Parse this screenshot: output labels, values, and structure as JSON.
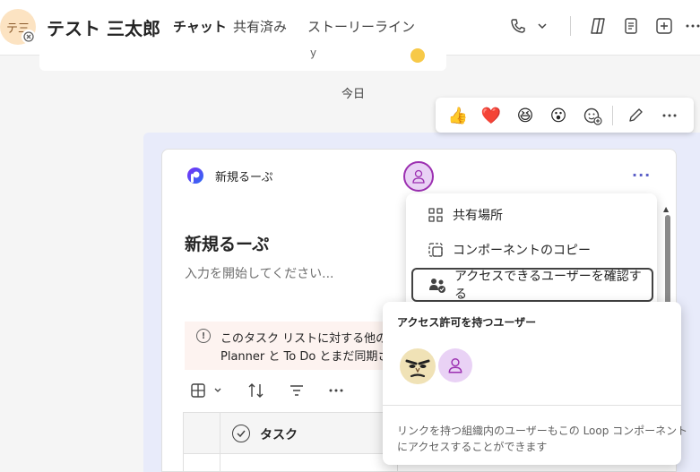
{
  "header": {
    "avatar_initials": "テ三",
    "title": "テスト 三太郎",
    "tabs": [
      {
        "label": "チャット",
        "active": true
      },
      {
        "label": "共有済み",
        "active": false
      },
      {
        "label": "ストーリーライン",
        "active": false
      }
    ],
    "icons": [
      "phone-icon",
      "chevron-down-icon",
      "copilot-icon",
      "notes-icon",
      "add-icon",
      "more-icon"
    ]
  },
  "chat": {
    "previous_message_fragment": "y",
    "date_separator": "今日"
  },
  "reactions": {
    "items": [
      {
        "name": "thumbs-up-icon",
        "glyph": "👍"
      },
      {
        "name": "heart-icon",
        "glyph": "❤️"
      },
      {
        "name": "laugh-icon",
        "glyph": "😆"
      },
      {
        "name": "surprised-icon",
        "glyph": "😮"
      }
    ],
    "tools": [
      "add-reaction-icon",
      "edit-icon",
      "more-icon"
    ]
  },
  "loop_card": {
    "name": "新規るーぷ",
    "title": "新規るーぷ",
    "placeholder": "入力を開始してください...",
    "more_label": "···",
    "notice_line1": "このタスク リストに対する他のユー",
    "notice_line2": "Planner と To Do とまだ同期され",
    "table": {
      "column_task": "タスク"
    }
  },
  "context_menu": {
    "items": [
      {
        "label": "共有場所",
        "icon": "share-location-icon"
      },
      {
        "label": "コンポーネントのコピー",
        "icon": "copy-component-icon"
      },
      {
        "label": "アクセスできるユーザーを確認する",
        "icon": "people-check-icon"
      }
    ]
  },
  "access_popover": {
    "title": "アクセス許可を持つユーザー",
    "note_line1": "リンクを持つ組織内のユーザーもこの Loop コンポーネント",
    "note_line2": "にアクセスすることができます"
  },
  "colors": {
    "accent": "#5b5fc7",
    "loop_avatar_border": "#9c2fb1",
    "avatar_bg": "#e9d2f5",
    "message_bg": "#e8ebfa"
  }
}
